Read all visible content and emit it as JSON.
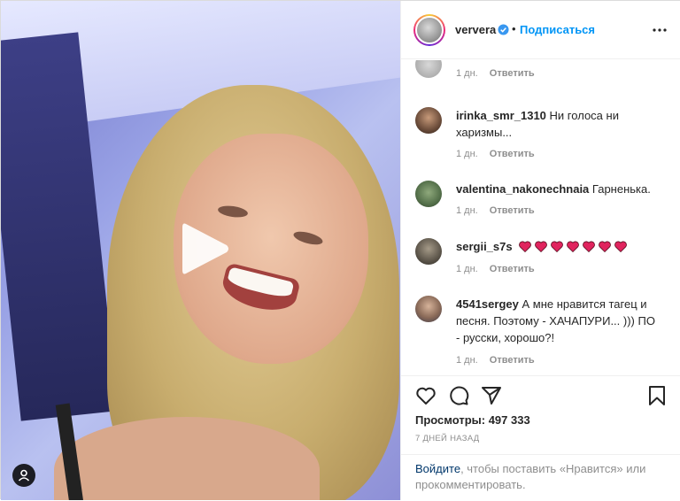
{
  "header": {
    "username": "ververa",
    "dot": "•",
    "follow_label": "Подписаться",
    "verified_icon": "verified-badge-icon",
    "more_icon": "more-options-icon"
  },
  "media": {
    "type": "video",
    "play_icon": "play-icon",
    "reel_icon": "reel-icon"
  },
  "comments": [
    {
      "username": "",
      "text": "",
      "time": "1 дн.",
      "reply": "Ответить",
      "partial": true
    },
    {
      "username": "irinka_smr_1310",
      "text": "Ни голоса ни харизмы...",
      "time": "1 дн.",
      "reply": "Ответить"
    },
    {
      "username": "valentina_nakonechnaia",
      "text": "Гарненька.",
      "time": "1 дн.",
      "reply": "Ответить"
    },
    {
      "username": "sergii_s7s",
      "text": "",
      "hearts": 7,
      "time": "1 дн.",
      "reply": "Ответить"
    },
    {
      "username": "4541sergey",
      "text": "А мне нравится тагец и песня. Поэтому - ХАЧАПУРИ... ))) ПО - русски, хорошо?!",
      "time": "1 дн.",
      "reply": "Ответить"
    }
  ],
  "actions": {
    "like_icon": "heart-icon",
    "comment_icon": "comment-icon",
    "share_icon": "share-icon",
    "save_icon": "bookmark-icon"
  },
  "stats": {
    "views_label": "Просмотры: 497 333",
    "date": "7 ДНЕЙ НАЗАД"
  },
  "login": {
    "link": "Войдите",
    "rest": ", чтобы поставить «Нравится» или прокомментировать."
  },
  "colors": {
    "accent": "#0095f6",
    "heart_red": "#ed4956",
    "link_dark": "#00376b",
    "muted": "#8e8e8e"
  }
}
